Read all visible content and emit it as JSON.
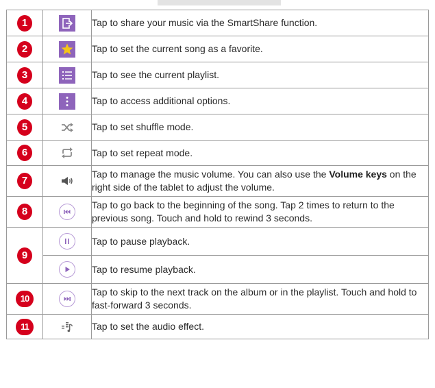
{
  "rows": [
    {
      "num": "1",
      "icon": "share-icon",
      "text": "Tap to share your music via the SmartShare function."
    },
    {
      "num": "2",
      "icon": "favorite-star-icon",
      "text": "Tap to set the current song as a favorite."
    },
    {
      "num": "3",
      "icon": "playlist-icon",
      "text": "Tap to see the current playlist."
    },
    {
      "num": "4",
      "icon": "more-options-icon",
      "text": "Tap to access additional options."
    },
    {
      "num": "5",
      "icon": "shuffle-icon",
      "text": "Tap to set shuffle mode."
    },
    {
      "num": "6",
      "icon": "repeat-icon",
      "text": "Tap to set repeat mode."
    },
    {
      "num": "7",
      "icon": "volume-icon",
      "text_before": "Tap to manage the music volume. You can also use the ",
      "keyword": "Volume keys",
      "text_after": " on the right side of the tablet to adjust the volume."
    },
    {
      "num": "8",
      "icon": "previous-track-icon",
      "text": "Tap to go back to the beginning of the song. Tap 2 times to return to the previous song. Touch and hold to rewind 3 seconds."
    },
    {
      "num": "9",
      "icon": "pause-icon",
      "text": "Tap to pause playback."
    },
    {
      "icon": "play-icon",
      "text": "Tap to resume playback."
    },
    {
      "num": "10",
      "icon": "next-track-icon",
      "text": "Tap to skip to the next track on the album or in the playlist. Touch and hold to fast-forward 3 seconds."
    },
    {
      "num": "11",
      "icon": "audio-effect-icon",
      "text": "Tap to set the audio effect."
    }
  ],
  "colors": {
    "badge": "#d5001c",
    "purple_square": "#8e64bb",
    "star": "#f5c518",
    "gray_icon": "#8a8a8a",
    "circle_border": "#b79ad6",
    "circle_glyph": "#8e64bb"
  }
}
